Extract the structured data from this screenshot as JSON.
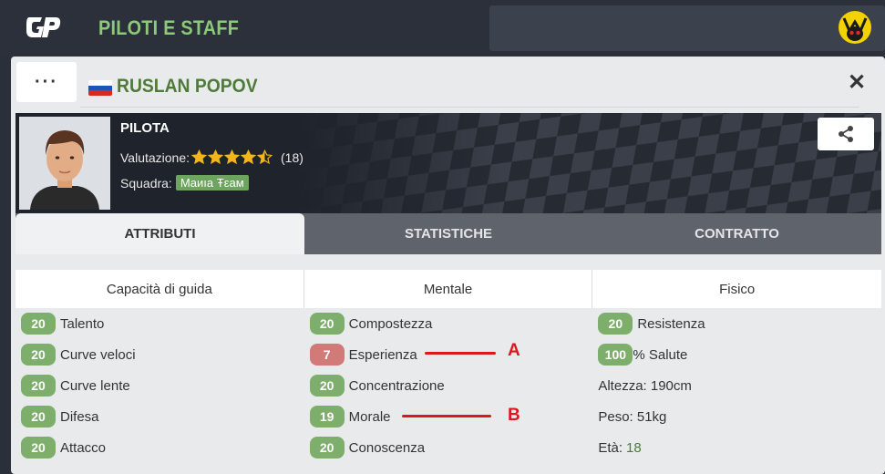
{
  "app": {
    "title": "PILOTI E STAFF"
  },
  "modal": {
    "menu_label": "···",
    "driver_name": "RUSLAN POPOV",
    "close_label": "✕"
  },
  "profile": {
    "role": "PILOTA",
    "rating_label": "Valutazione:",
    "rating_stars": 4.5,
    "rating_count": "(18)",
    "team_label": "Squadra:",
    "team_name": "Маиıа Ŧεaм"
  },
  "tabs": [
    {
      "label": "ATTRIBUTI",
      "active": true
    },
    {
      "label": "STATISTICHE",
      "active": false
    },
    {
      "label": "CONTRATTO",
      "active": false
    }
  ],
  "attributes": {
    "headers": [
      "Capacità di guida",
      "Mentale",
      "Fisico"
    ],
    "driving": [
      {
        "value": "20",
        "label": "Talento"
      },
      {
        "value": "20",
        "label": "Curve veloci"
      },
      {
        "value": "20",
        "label": "Curve lente"
      },
      {
        "value": "20",
        "label": "Difesa"
      },
      {
        "value": "20",
        "label": "Attacco"
      }
    ],
    "mental": [
      {
        "value": "20",
        "label": "Compostezza"
      },
      {
        "value": "7",
        "label": "Esperienza"
      },
      {
        "value": "20",
        "label": "Concentrazione"
      },
      {
        "value": "19",
        "label": "Morale"
      },
      {
        "value": "20",
        "label": "Conoscenza"
      }
    ],
    "physical": {
      "resistance": {
        "value": "20",
        "label": "Resistenza"
      },
      "health": {
        "value": "100",
        "label": "% Salute"
      },
      "height": "Altezza: 190cm",
      "weight": "Peso: 51kg",
      "age_label": "Età:",
      "age_value": "18"
    }
  },
  "annotations": {
    "a": "A",
    "b": "B"
  },
  "colors": {
    "accent_green": "#8cc97a",
    "value_green": "#7eae6c",
    "value_low": "#d17a77",
    "annotation_red": "#e0161d"
  }
}
